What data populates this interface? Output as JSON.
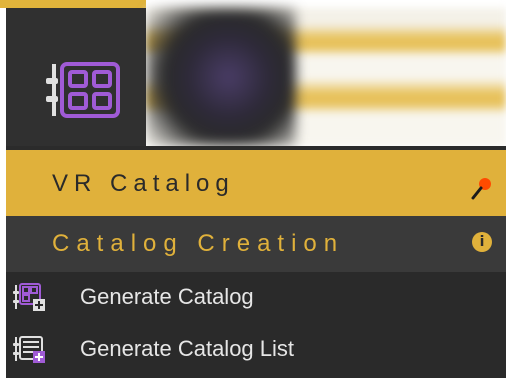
{
  "app": {
    "icon": "catalog-grid-icon",
    "accent_color": "#e0b13b"
  },
  "panel": {
    "title": "VR Catalog",
    "pin_icon": "pin-icon",
    "section": {
      "title": "Catalog Creation",
      "info_icon": "info-icon",
      "info_glyph": "i"
    },
    "items": [
      {
        "label": "Generate Catalog",
        "icon": "generate-catalog-icon"
      },
      {
        "label": "Generate Catalog List",
        "icon": "generate-catalog-list-icon"
      }
    ]
  }
}
